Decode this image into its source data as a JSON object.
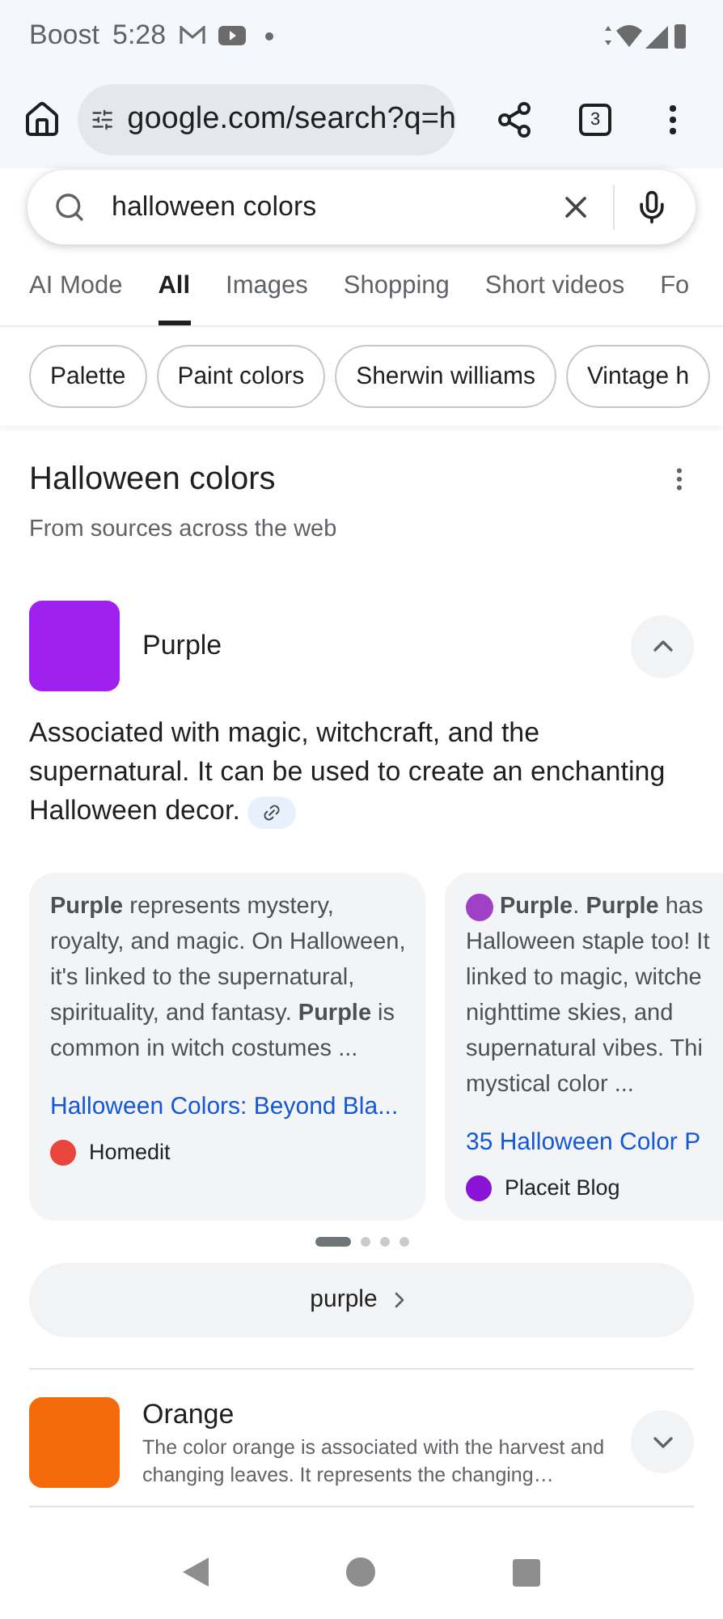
{
  "status_bar": {
    "carrier": "Boost",
    "time": "5:28"
  },
  "browser": {
    "url": "google.com/search?q=h",
    "tab_count": "3"
  },
  "search": {
    "value": "halloween colors"
  },
  "tabs": [
    {
      "label": "AI Mode",
      "selected": false
    },
    {
      "label": "All",
      "selected": true
    },
    {
      "label": "Images",
      "selected": false
    },
    {
      "label": "Shopping",
      "selected": false
    },
    {
      "label": "Short videos",
      "selected": false
    },
    {
      "label": "Fo",
      "selected": false
    }
  ],
  "chips": [
    "Palette",
    "Paint colors",
    "Sherwin williams",
    "Vintage h"
  ],
  "panel": {
    "title": "Halloween colors",
    "subtitle": "From sources across the web",
    "colors": [
      {
        "name": "Purple",
        "color": "#a020f0",
        "expanded": true,
        "description": "Associated with magic, witchcraft, and the supernatural. It can be used to create an enchanting Halloween decor.",
        "cards": [
          {
            "lines": [
              "**Purple** represents mystery, royalty, and magic. On Halloween, it's linked to the supernatural, spirituality, and fantasy. **Purple** is common in witch costumes ..."
            ],
            "link": "Halloween Colors: Beyond Bla...",
            "source": "Homedit",
            "color": "#e8453c"
          },
          {
            "lines": [
              "**Purple**. **Purple** has",
              "Halloween staple too! It",
              "linked to magic, witche",
              "nighttime skies, and",
              "supernatural vibes. Thi",
              "mystical color ..."
            ],
            "link": "35 Halloween Color P",
            "source": "Placeit Blog",
            "color": "#8a14d6"
          }
        ],
        "dots": [
          {
            "selected": true
          },
          {
            "selected": false
          },
          {
            "selected": false
          },
          {
            "selected": false
          }
        ],
        "more_button": "purple"
      },
      {
        "name": "Orange",
        "color": "#f56a0a",
        "expanded": false,
        "description": "The color orange is associated with the harvest and changing leaves. It represents the changing…"
      }
    ]
  }
}
